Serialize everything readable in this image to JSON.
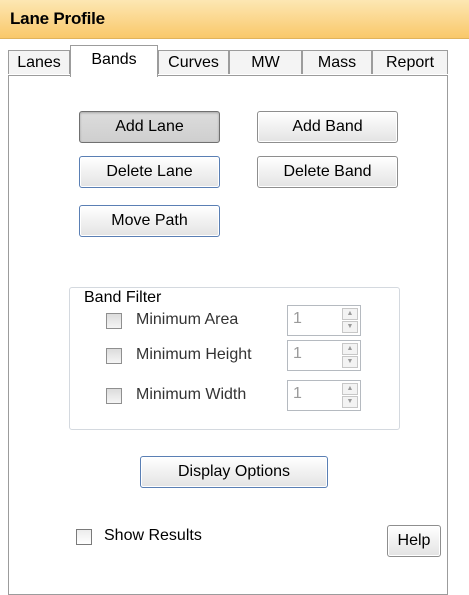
{
  "window": {
    "title": "Lane Profile"
  },
  "tabs": [
    {
      "label": "Lanes"
    },
    {
      "label": "Bands"
    },
    {
      "label": "Curves"
    },
    {
      "label": "MW"
    },
    {
      "label": "Mass"
    },
    {
      "label": "Report"
    }
  ],
  "active_tab": "Bands",
  "buttons": {
    "add_lane": "Add Lane",
    "add_band": "Add Band",
    "delete_lane": "Delete Lane",
    "delete_band": "Delete Band",
    "move_path": "Move Path",
    "display_options": "Display Options",
    "help": "Help"
  },
  "band_filter": {
    "title": "Band Filter",
    "items": [
      {
        "label": "Minimum Area",
        "checked": false,
        "value": "1"
      },
      {
        "label": "Minimum Height",
        "checked": false,
        "value": "1"
      },
      {
        "label": "Minimum Width",
        "checked": false,
        "value": "1"
      }
    ]
  },
  "show_results": {
    "label": "Show Results",
    "checked": false
  },
  "colors": {
    "title_gradient_top": "#fde7b3",
    "title_gradient_bottom": "#f9c86a",
    "button_border": "#5a7fb4"
  }
}
